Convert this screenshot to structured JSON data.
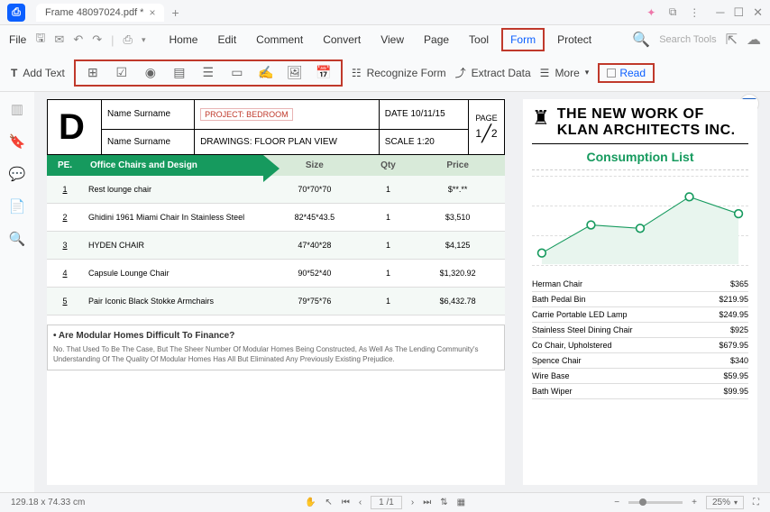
{
  "titlebar": {
    "tab_name": "Frame 48097024.pdf *"
  },
  "menu": {
    "file": "File",
    "items": [
      "Home",
      "Edit",
      "Comment",
      "Convert",
      "View",
      "Page",
      "Tool",
      "Form",
      "Protect"
    ],
    "search_ph": "Search Tools",
    "active": "Form"
  },
  "toolbar": {
    "add_text": "Add Text",
    "recognize": "Recognize Form",
    "extract": "Extract Data",
    "more": "More",
    "read": "Read"
  },
  "doc": {
    "header": {
      "ns1": "Name Surname",
      "ns2": "Name Surname",
      "project": "PROJECT: BEDROOM",
      "drawings": "DRAWINGS: FLOOR PLAN VIEW",
      "date": "DATE 10/11/15",
      "scale": "SCALE 1:20",
      "page_label": "PAGE",
      "page_a": "1",
      "page_b": "2"
    },
    "cols": {
      "pe": "PE.",
      "name": "Office Chairs and Design",
      "size": "Size",
      "qty": "Qty",
      "price": "Price"
    },
    "rows": [
      {
        "pe": "1",
        "name": "Rest lounge chair",
        "size": "70*70*70",
        "qty": "1",
        "price": "$**.**"
      },
      {
        "pe": "2",
        "name": "Ghidini 1961 Miami Chair In Stainless Steel",
        "size": "82*45*43.5",
        "qty": "1",
        "price": "$3,510"
      },
      {
        "pe": "3",
        "name": "HYDEN CHAIR",
        "size": "47*40*28",
        "qty": "1",
        "price": "$4,125"
      },
      {
        "pe": "4",
        "name": "Capsule Lounge Chair",
        "size": "90*52*40",
        "qty": "1",
        "price": "$1,320.92"
      },
      {
        "pe": "5",
        "name": "Pair Iconic Black Stokke Armchairs",
        "size": "79*75*76",
        "qty": "1",
        "price": "$6,432.78"
      }
    ],
    "faq": {
      "q": "Are Modular Homes Difficult To Finance?",
      "a": "No. That Used To Be The Case, But The Sheer Number Of Modular Homes Being Constructed, As Well As The Lending Community's Understanding Of The Quality Of Modular Homes Has All But Eliminated Any Previously Existing Prejudice."
    }
  },
  "right": {
    "title1": "THE NEW WORK OF",
    "title2": "KLAN ARCHITECTS INC.",
    "consumption": "Consumption List",
    "items": [
      {
        "n": "Herman Chair",
        "p": "$365"
      },
      {
        "n": "Bath Pedal Bin",
        "p": "$219.95"
      },
      {
        "n": "Carrie Portable LED Lamp",
        "p": "$249.95"
      },
      {
        "n": "Stainless Steel Dining Chair",
        "p": "$925"
      },
      {
        "n": "Co Chair, Upholstered",
        "p": "$679.95"
      },
      {
        "n": "Spence Chair",
        "p": "$340"
      },
      {
        "n": "Wire Base",
        "p": "$59.95"
      },
      {
        "n": "Bath Wiper",
        "p": "$99.95"
      }
    ]
  },
  "chart_data": {
    "type": "line",
    "title": "",
    "x": [
      1,
      2,
      3,
      4,
      5
    ],
    "values": [
      10,
      35,
      32,
      60,
      45
    ],
    "ylim": [
      0,
      70
    ]
  },
  "status": {
    "dims": "129.18 x 74.33 cm",
    "page_cur": "1",
    "page_total": "/1",
    "zoom": "25%"
  }
}
